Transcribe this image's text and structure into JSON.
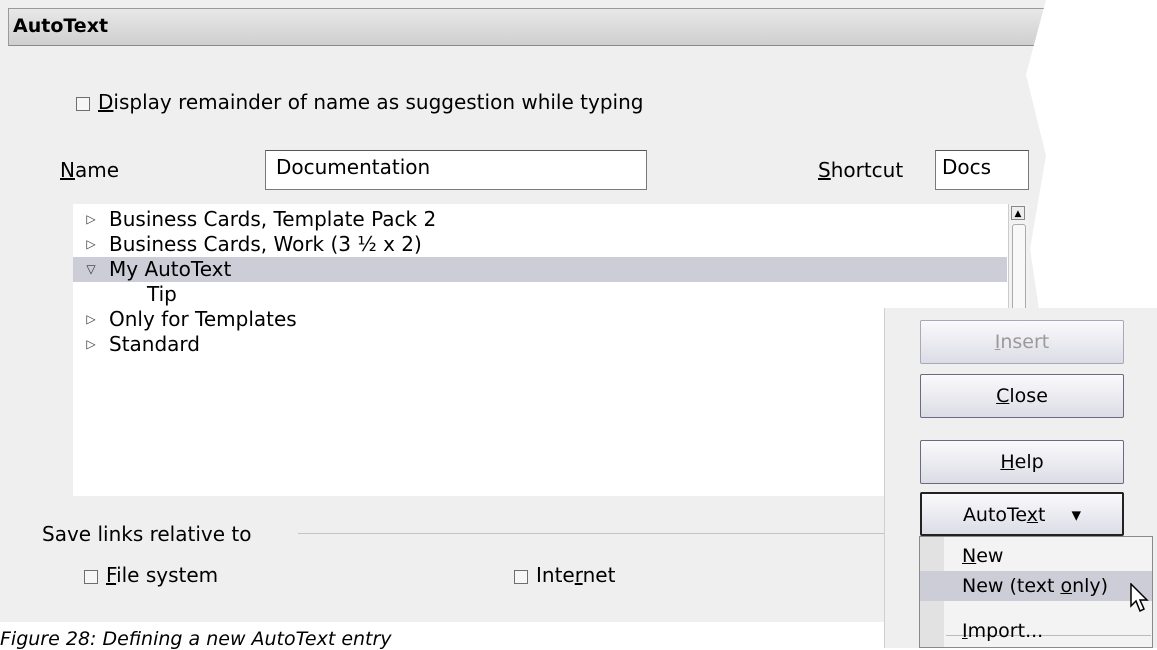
{
  "dialog": {
    "title": "AutoText",
    "display_remainder": {
      "prefix": "",
      "accel": "D",
      "rest": "isplay remainder of name as suggestion while typing",
      "checked": false
    },
    "name_label": {
      "accel": "N",
      "rest": "ame"
    },
    "name_value": "Documentation",
    "shortcut_label": {
      "accel": "S",
      "rest": "hortcut"
    },
    "shortcut_value": "Docs",
    "tree": [
      {
        "label": "Business Cards, Template Pack 2",
        "expanded": false
      },
      {
        "label": "Business Cards, Work (3 ½ x 2)",
        "expanded": false
      },
      {
        "label": "My AutoText",
        "expanded": true,
        "selected": true
      },
      {
        "label": "Tip",
        "child": true
      },
      {
        "label": "Only for Templates",
        "expanded": false
      },
      {
        "label": "Standard",
        "expanded": false
      }
    ],
    "save_links": {
      "label": "Save links relative to",
      "file_system": {
        "accel": "F",
        "rest": "ile system",
        "checked": false
      },
      "internet": {
        "pre": "Inte",
        "accel": "r",
        "rest": "net",
        "checked": false
      }
    }
  },
  "buttons": {
    "insert": {
      "accel": "I",
      "rest": "nsert",
      "enabled": false
    },
    "close": {
      "accel": "C",
      "rest": "lose"
    },
    "help": {
      "accel": "H",
      "rest": "elp"
    },
    "autotext": {
      "pre": "AutoTe",
      "accel": "x",
      "rest": "t",
      "arrow": "▾"
    }
  },
  "menu": [
    {
      "accel": "N",
      "rest": "ew"
    },
    {
      "pre": "New (text ",
      "accel": "o",
      "rest": "nly)",
      "highlighted": true
    },
    {
      "accel": "I",
      "rest": "mport..."
    }
  ],
  "caption": "Figure 28: Defining a new AutoText entry",
  "colors": {
    "selection": "#cdcdd8",
    "dialog_bg": "#efefef"
  }
}
